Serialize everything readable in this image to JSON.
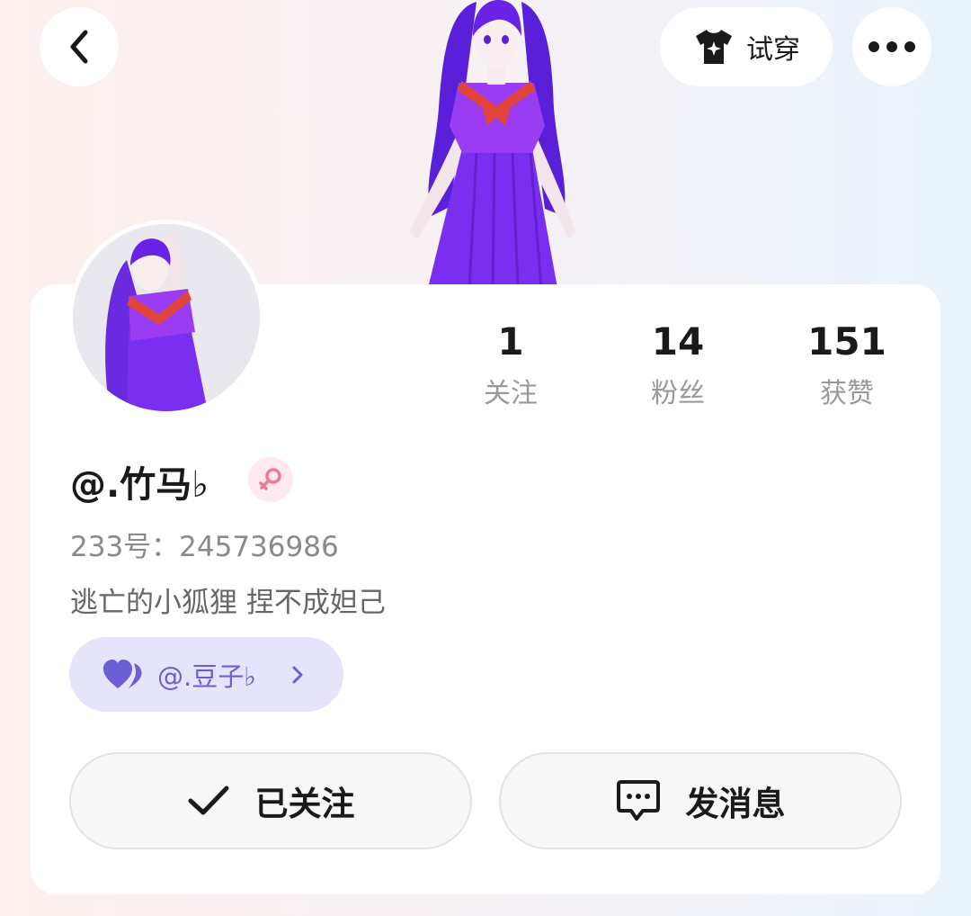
{
  "header": {
    "tryon_label": "试穿",
    "icons": {
      "back": "back-arrow-icon",
      "tryon": "tshirt-sparkle-icon",
      "more": "more-dots-icon"
    }
  },
  "stats": [
    {
      "value": "1",
      "label": "关注"
    },
    {
      "value": "14",
      "label": "粉丝"
    },
    {
      "value": "151",
      "label": "获赞"
    }
  ],
  "profile": {
    "username": "@.竹马♭",
    "gender_icon": "female-symbol-icon",
    "uid": "233号：245736986",
    "bio": "逃亡的小狐狸 捏不成妲己"
  },
  "cp_tag": {
    "icon": "double-heart-icon",
    "name": "@.豆子♭"
  },
  "actions": {
    "follow_label": "已关注",
    "message_label": "发消息"
  },
  "colors": {
    "accent_purple": "#6b5fd6",
    "tag_bg": "#e6e4fb",
    "gender_pink": "#f07a96",
    "avatar_dress": "#7a2ff0"
  }
}
